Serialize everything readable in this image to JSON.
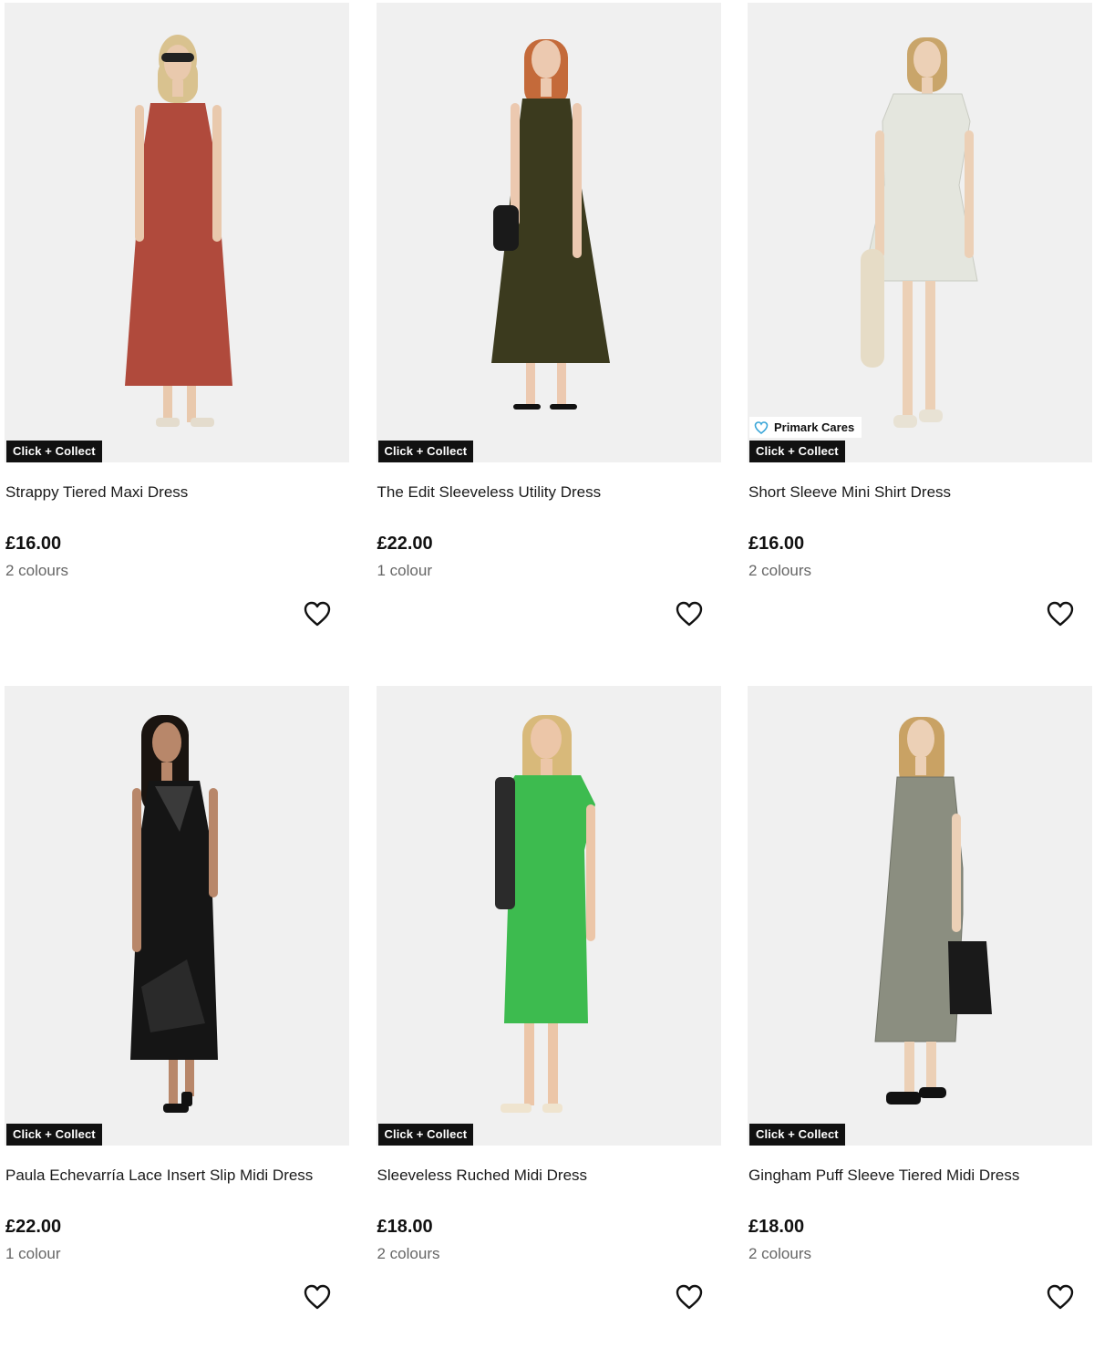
{
  "badges": {
    "click_collect": "Click + Collect",
    "primark_cares": "Primark Cares"
  },
  "products": [
    {
      "name": "Strappy Tiered Maxi Dress",
      "price": "£16.00",
      "colours": "2 colours",
      "dress_color": "#b04a3c",
      "hair_color": "#d9c28f",
      "icon": "heart-outline-icon"
    },
    {
      "name": "The Edit Sleeveless Utility Dress",
      "price": "£22.00",
      "colours": "1 colour",
      "dress_color": "#3b3a1e",
      "hair_color": "#c46a3a",
      "icon": "heart-outline-icon"
    },
    {
      "name": "Short Sleeve Mini Shirt Dress",
      "price": "£16.00",
      "colours": "2 colours",
      "dress_color": "#e4e6de",
      "hair_color": "#c9a56a",
      "icon": "heart-outline-icon"
    },
    {
      "name": "Paula Echevarría Lace Insert Slip Midi Dress",
      "price": "£22.00",
      "colours": "1 colour",
      "dress_color": "#151515",
      "hair_color": "#1a1410",
      "icon": "heart-outline-icon"
    },
    {
      "name": "Sleeveless Ruched Midi Dress",
      "price": "£18.00",
      "colours": "2 colours",
      "dress_color": "#3dbb4f",
      "hair_color": "#d8b97a",
      "icon": "heart-outline-icon"
    },
    {
      "name": "Gingham Puff Sleeve Tiered Midi Dress",
      "price": "£18.00",
      "colours": "2 colours",
      "dress_color": "#8b8e80",
      "hair_color": "#c9a264",
      "icon": "heart-outline-icon"
    }
  ],
  "colors": {
    "page_bg": "#ffffff",
    "image_bg": "#f0f0f0",
    "badge_bg": "#111111",
    "badge_text": "#ffffff",
    "cares_heart": "#3aa6d8",
    "price_text": "#111111",
    "secondary_text": "#666666"
  }
}
